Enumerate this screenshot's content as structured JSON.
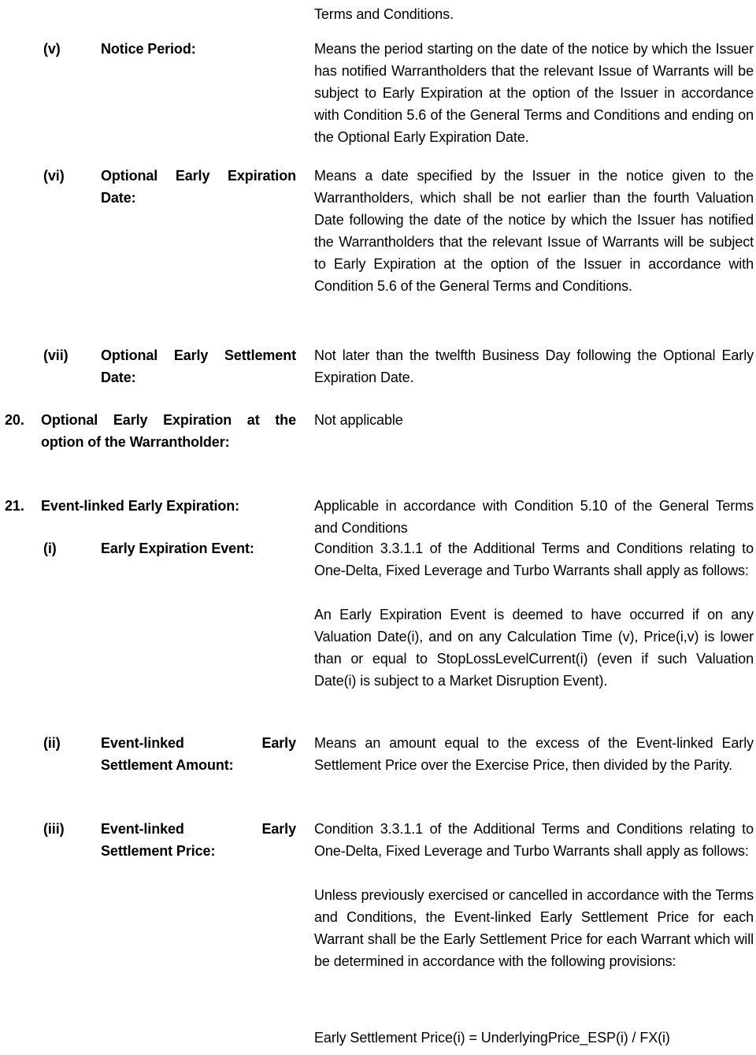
{
  "document": {
    "type": "warrant-terms-final-terms",
    "continuation_line": "Terms and Conditions."
  },
  "rows": [
    {
      "id": "notice-period",
      "num": "(v)",
      "num_style": "roman",
      "label_line1": "Notice Period:",
      "label_line2": "",
      "label_justified": false,
      "content": [
        "Means the period starting on the date of the notice by which the Issuer has notified Warrantholders that the relevant Issue of Warrants will be subject to Early Expiration at the option of the Issuer in accordance with Condition 5.6 of the General Terms and Conditions and ending on the Optional Early Expiration Date."
      ]
    },
    {
      "id": "optional-early-expiration-date",
      "num": "(vi)",
      "num_style": "roman",
      "label_line1": "Optional Early Expiration",
      "label_line2": "Date:",
      "label_justified": true,
      "content": [
        "Means a date specified by the Issuer in the notice given to the Warrantholders, which shall be not earlier than the fourth Valuation Date following the date of the notice by which the Issuer has notified the Warrantholders that the relevant Issue of Warrants will be subject to Early Expiration at the option of the Issuer in accordance with Condition 5.6 of the General Terms and Conditions."
      ]
    },
    {
      "id": "optional-early-settlement-date",
      "num": "(vii)",
      "num_style": "roman",
      "label_line1": "Optional Early Settlement",
      "label_line2": "Date:",
      "label_justified": true,
      "content": [
        "Not later than the twelfth Business Day following the Optional Early Expiration Date."
      ]
    },
    {
      "id": "optional-early-expiration-warrantholder",
      "num": "20.",
      "num_style": "arabic",
      "label_line1": "Optional Early Expiration at the",
      "label_line2": "option of the Warrantholder:",
      "label_justified": true,
      "content": [
        "Not applicable"
      ]
    },
    {
      "id": "event-linked-early-expiration",
      "num": "21.",
      "num_style": "arabic",
      "label_line1": "Event-linked Early Expiration:",
      "label_line2": "",
      "label_justified": false,
      "content": [
        "Applicable in accordance with Condition 5.10 of the General Terms and Conditions"
      ]
    },
    {
      "id": "early-expiration-event",
      "num": "(i)",
      "num_style": "roman",
      "label_line1": "Early Expiration Event:",
      "label_line2": "",
      "label_justified": false,
      "content": [
        "Condition 3.3.1.1 of the Additional Terms and Conditions relating to One-Delta, Fixed Leverage and Turbo Warrants shall apply as follows:",
        "An Early Expiration Event is deemed to have occurred if on any Valuation Date(i), and on any Calculation Time (v), Price(i,v) is lower than or equal to StopLossLevelCurrent(i) (even if such Valuation Date(i) is subject to a Market Disruption Event)."
      ]
    },
    {
      "id": "event-linked-early-settlement-amount",
      "num": "(ii)",
      "num_style": "roman",
      "label_line1": "Event-linked Early",
      "label_line2": "Settlement Amount:",
      "label_justified": true,
      "content": [
        "Means an amount equal to the excess of the Event-linked Early Settlement Price over the Exercise Price, then divided by the Parity."
      ]
    },
    {
      "id": "event-linked-early-settlement-price",
      "num": "(iii)",
      "num_style": "roman",
      "label_line1": "Event-linked Early",
      "label_line2": "Settlement Price:",
      "label_justified": true,
      "content": [
        "Condition 3.3.1.1 of the Additional Terms and Conditions relating to One-Delta, Fixed Leverage and Turbo Warrants shall apply as follows:",
        "Unless previously exercised or cancelled in accordance with the Terms and Conditions, the Event-linked Early Settlement Price for each Warrant shall be the Early Settlement Price for each Warrant which will be determined in accordance with the following provisions:"
      ]
    }
  ],
  "formula": {
    "text": "Early Settlement Price(i) = UnderlyingPrice_ESP(i) / FX(i)"
  }
}
